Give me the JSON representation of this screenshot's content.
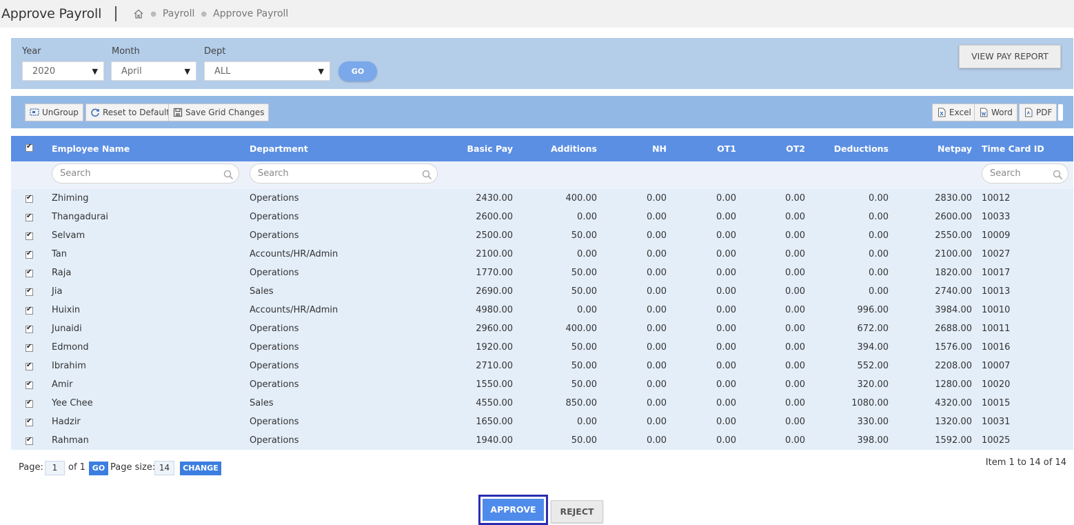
{
  "header": {
    "title": "Approve Payroll",
    "breadcrumb": [
      "Payroll",
      "Approve Payroll"
    ]
  },
  "filters": {
    "year_label": "Year",
    "year_value": "2020",
    "month_label": "Month",
    "month_value": "April",
    "dept_label": "Dept",
    "dept_value": "ALL",
    "go_label": "GO",
    "view_report_label": "VIEW PAY REPORT"
  },
  "toolbar": {
    "ungroup": "UnGroup",
    "reset": "Reset to Default",
    "save": "Save Grid Changes",
    "excel": "Excel",
    "word": "Word",
    "pdf": "PDF"
  },
  "grid": {
    "columns": [
      "Employee Name",
      "Department",
      "Basic Pay",
      "Additions",
      "NH",
      "OT1",
      "OT2",
      "Deductions",
      "Netpay",
      "Time Card ID"
    ],
    "search_placeholder": "Search",
    "rows": [
      [
        "Zhiming",
        "Operations",
        "2430.00",
        "400.00",
        "0.00",
        "0.00",
        "0.00",
        "0.00",
        "2830.00",
        "10012"
      ],
      [
        "Thangadurai",
        "Operations",
        "2600.00",
        "0.00",
        "0.00",
        "0.00",
        "0.00",
        "0.00",
        "2600.00",
        "10033"
      ],
      [
        "Selvam",
        "Operations",
        "2500.00",
        "50.00",
        "0.00",
        "0.00",
        "0.00",
        "0.00",
        "2550.00",
        "10009"
      ],
      [
        "Tan",
        "Accounts/HR/Admin",
        "2100.00",
        "0.00",
        "0.00",
        "0.00",
        "0.00",
        "0.00",
        "2100.00",
        "10027"
      ],
      [
        "Raja",
        "Operations",
        "1770.00",
        "50.00",
        "0.00",
        "0.00",
        "0.00",
        "0.00",
        "1820.00",
        "10017"
      ],
      [
        "Jia",
        "Sales",
        "2690.00",
        "50.00",
        "0.00",
        "0.00",
        "0.00",
        "0.00",
        "2740.00",
        "10013"
      ],
      [
        "Huixin",
        "Accounts/HR/Admin",
        "4980.00",
        "0.00",
        "0.00",
        "0.00",
        "0.00",
        "996.00",
        "3984.00",
        "10010"
      ],
      [
        "Junaidi",
        "Operations",
        "2960.00",
        "400.00",
        "0.00",
        "0.00",
        "0.00",
        "672.00",
        "2688.00",
        "10011"
      ],
      [
        "Edmond",
        "Operations",
        "1920.00",
        "50.00",
        "0.00",
        "0.00",
        "0.00",
        "394.00",
        "1576.00",
        "10016"
      ],
      [
        "Ibrahim",
        "Operations",
        "2710.00",
        "50.00",
        "0.00",
        "0.00",
        "0.00",
        "552.00",
        "2208.00",
        "10007"
      ],
      [
        "Amir",
        "Operations",
        "1550.00",
        "50.00",
        "0.00",
        "0.00",
        "0.00",
        "320.00",
        "1280.00",
        "10020"
      ],
      [
        "Yee Chee",
        "Sales",
        "4550.00",
        "850.00",
        "0.00",
        "0.00",
        "0.00",
        "1080.00",
        "4320.00",
        "10015"
      ],
      [
        "Hadzir",
        "Operations",
        "1650.00",
        "0.00",
        "0.00",
        "0.00",
        "0.00",
        "330.00",
        "1320.00",
        "10031"
      ],
      [
        "Rahman",
        "Operations",
        "1940.00",
        "50.00",
        "0.00",
        "0.00",
        "0.00",
        "398.00",
        "1592.00",
        "10025"
      ]
    ]
  },
  "pager": {
    "page_label": "Page:",
    "page_value": "1",
    "of_label": "of 1",
    "go_label": "GO",
    "size_label": "Page size:",
    "size_value": "14",
    "change_label": "CHANGE",
    "items_info": "Item 1 to 14 of 14"
  },
  "actions": {
    "approve": "APPROVE",
    "reject": "REJECT"
  },
  "colors": {
    "header_blue": "#5b8fe3",
    "panel_blue": "#b4cde9",
    "toolbar_blue": "#92b8e6",
    "row_bg": "#e4eef9",
    "approve_blue": "#4f8bea"
  }
}
